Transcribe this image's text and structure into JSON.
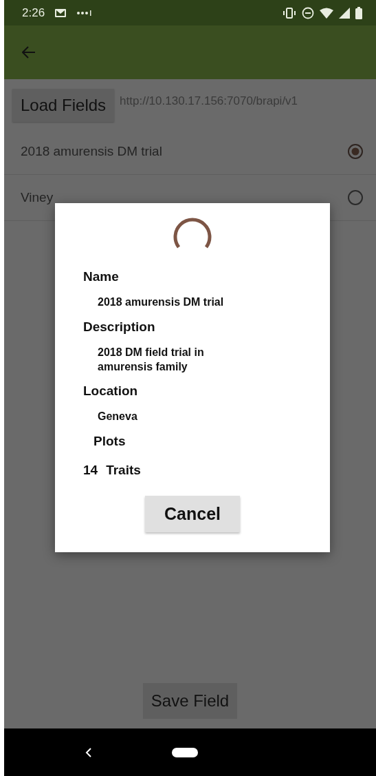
{
  "status_bar": {
    "time": "2:26"
  },
  "toolbar": {
    "url": "http://10.130.17.156:7070/brapi/v1",
    "load_button": "Load Fields"
  },
  "fields": [
    {
      "name": "2018 amurensis DM trial",
      "selected": true
    },
    {
      "name": "Viney",
      "selected": false
    }
  ],
  "dialog": {
    "sections": [
      {
        "label": "Name",
        "value": "2018 amurensis DM trial"
      },
      {
        "label": "Description",
        "value": "2018 DM field trial in amurensis family"
      },
      {
        "label": "Location",
        "value": "Geneva"
      }
    ],
    "counts": [
      {
        "label": "Plots"
      },
      {
        "count": "14",
        "label": "Traits"
      }
    ],
    "cancel_button": "Cancel"
  },
  "save_button": "Save Field"
}
